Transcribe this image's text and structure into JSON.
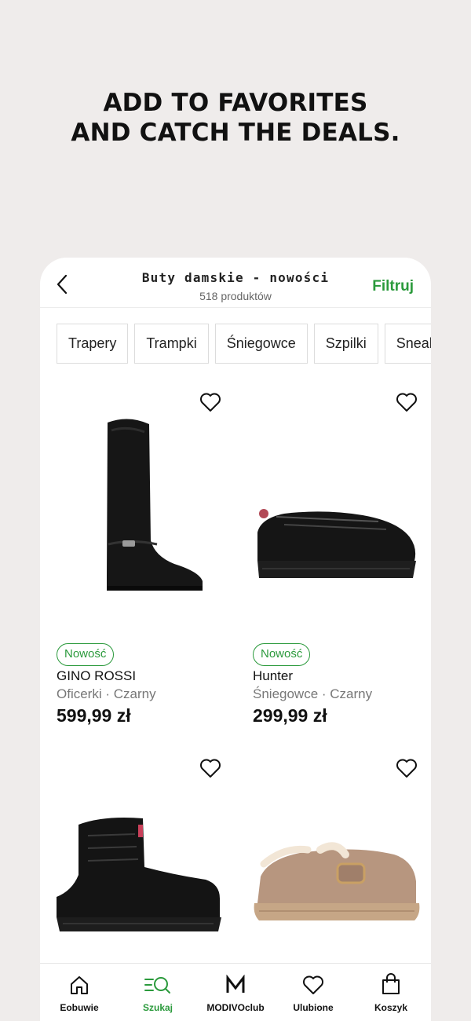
{
  "promo": {
    "line1": "ADD TO FAVORITES",
    "line2": "AND CATCH THE DEALS."
  },
  "header": {
    "title": "Buty damskie - nowości",
    "subtitle": "518 produktów",
    "filter_label": "Filtruj",
    "back_icon": "chevron-left-icon"
  },
  "chips": [
    "Trapery",
    "Trampki",
    "Śniegowce",
    "Szpilki",
    "Sneakersy"
  ],
  "products": [
    {
      "badge": "Nowość",
      "brand": "GINO ROSSI",
      "meta": "Oficerki · Czarny",
      "price": "599,99 zł",
      "image": "black-knee-high-boot"
    },
    {
      "badge": "Nowość",
      "brand": "Hunter",
      "meta": "Śniegowce · Czarny",
      "price": "299,99 zł",
      "image": "black-quilted-snow-shoe"
    },
    {
      "image": "black-lace-up-snow-boot"
    },
    {
      "image": "beige-shearling-clog"
    }
  ],
  "nav": [
    {
      "label": "Eobuwie",
      "icon": "home-icon"
    },
    {
      "label": "Szukaj",
      "icon": "search-filter-icon",
      "active": true
    },
    {
      "label": "MODIVOclub",
      "icon": "modivo-m-icon"
    },
    {
      "label": "Ulubione",
      "icon": "heart-icon"
    },
    {
      "label": "Koszyk",
      "icon": "bag-icon"
    }
  ],
  "colors": {
    "accent": "#2b9a3c",
    "background": "#efeceb",
    "card": "#ffffff"
  }
}
